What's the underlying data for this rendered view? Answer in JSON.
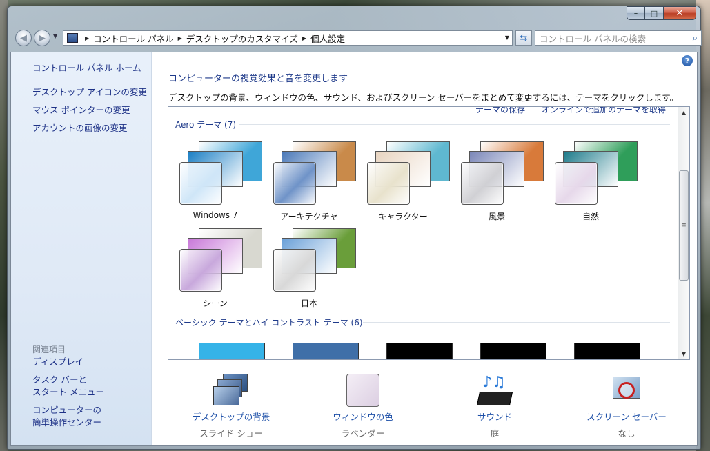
{
  "window": {
    "caption": {
      "minimize": "–",
      "maximize": "□",
      "close": "✕"
    }
  },
  "nav": {
    "back": "◀",
    "forward": "▶",
    "breadcrumbs": [
      "コントロール パネル",
      "デスクトップのカスタマイズ",
      "個人設定"
    ],
    "search_placeholder": "コントロール パネルの検索"
  },
  "sidebar": {
    "home": "コントロール パネル ホーム",
    "links": [
      "デスクトップ アイコンの変更",
      "マウス ポインターの変更",
      "アカウントの画像の変更"
    ],
    "related_heading": "関連項目",
    "related": [
      "ディスプレイ",
      "タスク バーと",
      "スタート メニュー",
      "コンピューターの",
      "簡単操作センター"
    ]
  },
  "main": {
    "heading": "コンピューターの視覚効果と音を変更します",
    "description": "デスクトップの背景、ウィンドウの色、サウンド、およびスクリーン セーバーをまとめて変更するには、テーマをクリックします。",
    "top_links": "テーマの保存　　オンラインで追加のテーマを取得",
    "aero_group": "Aero テーマ (7)",
    "basic_group": "ベーシック テーマとハイ コントラスト テーマ (6)",
    "themes": [
      {
        "name": "Windows 7",
        "back": "#3fa6d8",
        "mid": "#1b7fc4",
        "swatch": "#cfe6f8"
      },
      {
        "name": "アーキテクチャ",
        "back": "#c98a4a",
        "mid": "#4a78b8",
        "swatch": "#6f93c8"
      },
      {
        "name": "キャラクター",
        "back": "#5fb8d0",
        "mid": "#e8d4c0",
        "swatch": "#e8e2cc"
      },
      {
        "name": "風景",
        "back": "#d87a3a",
        "mid": "#7a86b8",
        "swatch": "#d0d0d4"
      },
      {
        "name": "自然",
        "back": "#2f9e5a",
        "mid": "#1c7a8a",
        "swatch": "#e6d8ea"
      },
      {
        "name": "シーン",
        "back": "#d8d8d0",
        "mid": "#c878d8",
        "swatch": "#c8a8dc"
      },
      {
        "name": "日本",
        "back": "#6a9e3a",
        "mid": "#6aa0d8",
        "swatch": "#d8d8d8"
      }
    ],
    "basic_colors": [
      "#35b3e8",
      "#3f6fa8",
      "#000000",
      "#000000",
      "#000000"
    ]
  },
  "bottom": [
    {
      "label": "デスクトップの背景",
      "sub": "スライド ショー",
      "icon": "desktop-background-icon"
    },
    {
      "label": "ウィンドウの色",
      "sub": "ラベンダー",
      "icon": "window-color-icon"
    },
    {
      "label": "サウンド",
      "sub": "庭",
      "icon": "sound-icon"
    },
    {
      "label": "スクリーン セーバー",
      "sub": "なし",
      "icon": "screen-saver-icon"
    }
  ]
}
